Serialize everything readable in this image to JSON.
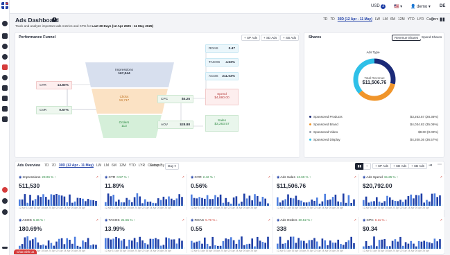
{
  "topbar": {
    "currency": "USD",
    "currency_badge": "2",
    "user": "demo",
    "lang": "DE"
  },
  "header": {
    "title": "Ads Dashboard",
    "subtitle_prefix": "Track and analyze important ads metrics and KPIs for ",
    "subtitle_range": "Last 30 Days (12 Apr 2025 - 11 May 2025)",
    "ranges": [
      "7D",
      "7D",
      "30D (12 Apr - 11 May)",
      "LW",
      "LM",
      "6M",
      "12M",
      "YTD",
      "LYR",
      "Custom"
    ]
  },
  "funnel": {
    "title": "Performance Funnel",
    "tabs": [
      "SP Ads",
      "SD Ads",
      "SB Ads"
    ],
    "roas": {
      "label": "ROAS",
      "value": "0.47"
    },
    "tacos": {
      "label": "TACOS",
      "value": "4.63%"
    },
    "acos": {
      "label": "ACOS",
      "value": "211.03%"
    },
    "ctr": {
      "label": "CTR",
      "value": "13.80%"
    },
    "cvr": {
      "label": "CVR",
      "value": "0.57%"
    },
    "cpc": {
      "label": "CPC",
      "value": "$0.25"
    },
    "aov": {
      "label": "AOV",
      "value": "$28.88"
    },
    "impressions": {
      "label": "Impressions",
      "value": "167,044"
    },
    "clicks": {
      "label": "Clicks",
      "value": "19,717"
    },
    "orders": {
      "label": "Orders",
      "value": "113"
    },
    "spend": {
      "label": "Spend",
      "value": "$4,880.00"
    },
    "sales": {
      "label": "Sales",
      "value": "$3,263.57"
    }
  },
  "shares": {
    "title": "Shares",
    "tabs": [
      "Revenue Shares",
      "Spend Shares"
    ],
    "chart_label": "Ads Type",
    "total_label": "Total Revenue",
    "total_value": "$11,506.76",
    "rows": [
      {
        "name": "Sponsored Products",
        "value": "$3,263.57 (28.36%)",
        "color": "#1b2a78"
      },
      {
        "name": "Sponsored Brand",
        "value": "$4,034.82 (35.06%)",
        "color": "#f0952b"
      },
      {
        "name": "Sponsored Video",
        "value": "$0.00 (0.00%)",
        "color": "#9aa0ad"
      },
      {
        "name": "Sponsored Display",
        "value": "$4,208.36 (36.57%)",
        "color": "#2ec0e8"
      }
    ]
  },
  "overview": {
    "title": "Ads Overview",
    "ranges": [
      "7D",
      "7D",
      "30D (12 Apr - 11 May)",
      "LW",
      "LM",
      "6M",
      "12M",
      "YTD",
      "LYR",
      "Custom"
    ],
    "group_by_label": "Group By",
    "group_by_value": "Day",
    "tabs": [
      "SP Ads",
      "SD Ads",
      "SB Ads"
    ],
    "axis_dates": "12 Apr 14 Apr 16 Apr 18 Apr 20 Apr 22 Apr 24 Apr 26 Apr 28 Apr",
    "metrics": [
      {
        "name": "Impressions",
        "change": "23.06 %",
        "value": "511,530",
        "dir": "up"
      },
      {
        "name": "CTR",
        "change": "0.57 %",
        "value": "11.89%",
        "dir": "up"
      },
      {
        "name": "CVR",
        "change": "2.42 %",
        "value": "0.56%",
        "dir": "up"
      },
      {
        "name": "Ads Sales",
        "change": "13.69 %",
        "value": "$11,506.76",
        "dir": "up"
      },
      {
        "name": "Ads Spend",
        "change": "15.25 %",
        "value": "$20,792.00",
        "dir": "up"
      },
      {
        "name": "ACOS",
        "change": "5.36 %",
        "value": "180.69%",
        "dir": "up"
      },
      {
        "name": "TACOS",
        "change": "21.55 %",
        "value": "13.99%",
        "dir": "up"
      },
      {
        "name": "ROAS",
        "change": "5.79 %",
        "value": "0.55",
        "dir": "down"
      },
      {
        "name": "Ads Orders",
        "change": "30.52 %",
        "value": "338",
        "dir": "up"
      },
      {
        "name": "CPC",
        "change": "8.11 %",
        "value": "$0.34",
        "dir": "down"
      }
    ]
  },
  "chat": {
    "label": "Chat with us"
  }
}
